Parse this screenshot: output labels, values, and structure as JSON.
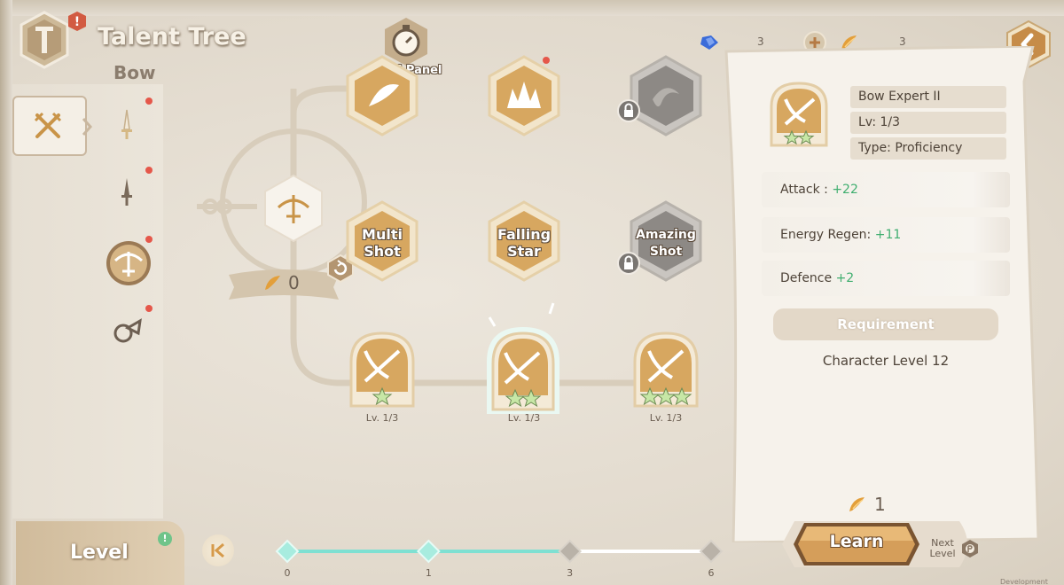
{
  "header": {
    "title": "Talent Tree",
    "subtitle": "Bow",
    "alert_glyph": "!"
  },
  "currency": [
    {
      "icon": "blue-crystal-icon",
      "amount": "3"
    },
    {
      "icon": "gold-feather-icon",
      "amount": "3"
    }
  ],
  "sidebar": {
    "tabs": [
      {
        "icon": "crossed-swords-icon",
        "active": true
      },
      {
        "icon": "sword-icon",
        "badge": true
      },
      {
        "icon": "dagger-icon",
        "badge": true
      },
      {
        "icon": "bow-icon",
        "badge": true
      },
      {
        "icon": "shield-horn-icon",
        "badge": true
      }
    ]
  },
  "tree": {
    "skill_panel_label": "Skill Panel",
    "root_points": "0",
    "row_actives": [
      {
        "label": "",
        "icon": "arrow-burst-icon",
        "locked": false
      },
      {
        "label": "",
        "icon": "spikes-icon",
        "locked": false
      },
      {
        "label": "",
        "icon": "swirl-icon",
        "locked": true
      }
    ],
    "row_skills": [
      {
        "label": "Multi Shot",
        "lines": [
          "Multi",
          "Shot"
        ],
        "locked": false
      },
      {
        "label": "Falling Star",
        "lines": [
          "Falling",
          "Star"
        ],
        "locked": false
      },
      {
        "label": "Amazing Shot",
        "lines": [
          "Amazing",
          "Shot"
        ],
        "locked": true
      }
    ],
    "row_proficiency": [
      {
        "stars": 1,
        "level": "Lv. 1/3"
      },
      {
        "stars": 2,
        "level": "Lv. 1/3",
        "selected": true
      },
      {
        "stars": 3,
        "level": "Lv. 1/3"
      }
    ]
  },
  "detail": {
    "name": "Bow Expert II",
    "level": "Lv: 1/3",
    "type": "Type:  Proficiency",
    "stats": [
      {
        "label": "Attack : ",
        "value": "+22"
      },
      {
        "label": "Energy Regen: ",
        "value": "+11"
      },
      {
        "label": "Defence  ",
        "value": "+2"
      }
    ],
    "requirement_header": "Requirement",
    "requirement_text": "Character Level 12",
    "cost": "1",
    "learn_label": "Learn",
    "next_level_label": "Next Level"
  },
  "level_bar": {
    "label": "Level",
    "alert_glyph": "!",
    "ticks": [
      "0",
      "1",
      "3",
      "6"
    ],
    "progress_fraction": 0.66
  },
  "watermark": "Development Build",
  "colors": {
    "accent_gold": "#d9a75e",
    "stat_green": "#3fae6f",
    "progress_teal": "#7fe0d2",
    "badge_red": "#e5574a"
  }
}
